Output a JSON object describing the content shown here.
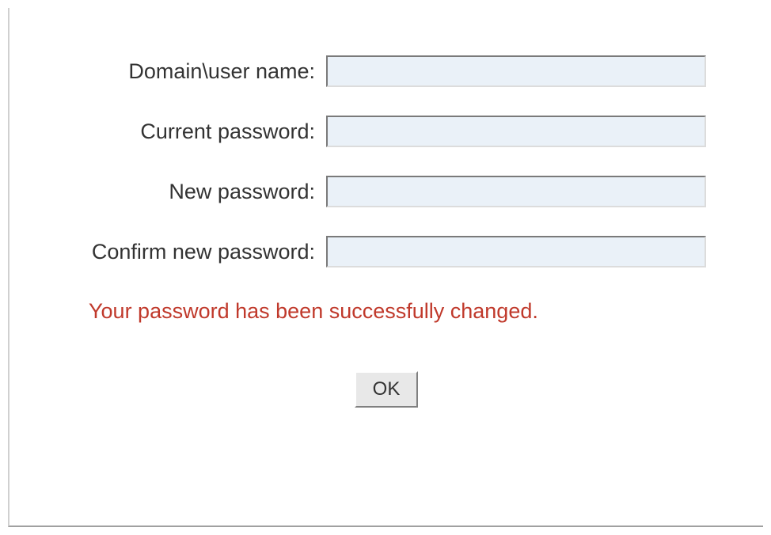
{
  "form": {
    "fields": [
      {
        "label": "Domain\\user name:",
        "value": ""
      },
      {
        "label": "Current password:",
        "value": ""
      },
      {
        "label": "New password:",
        "value": ""
      },
      {
        "label": "Confirm new password:",
        "value": ""
      }
    ]
  },
  "status_message": "Your password has been successfully changed.",
  "buttons": {
    "ok_label": "OK"
  }
}
